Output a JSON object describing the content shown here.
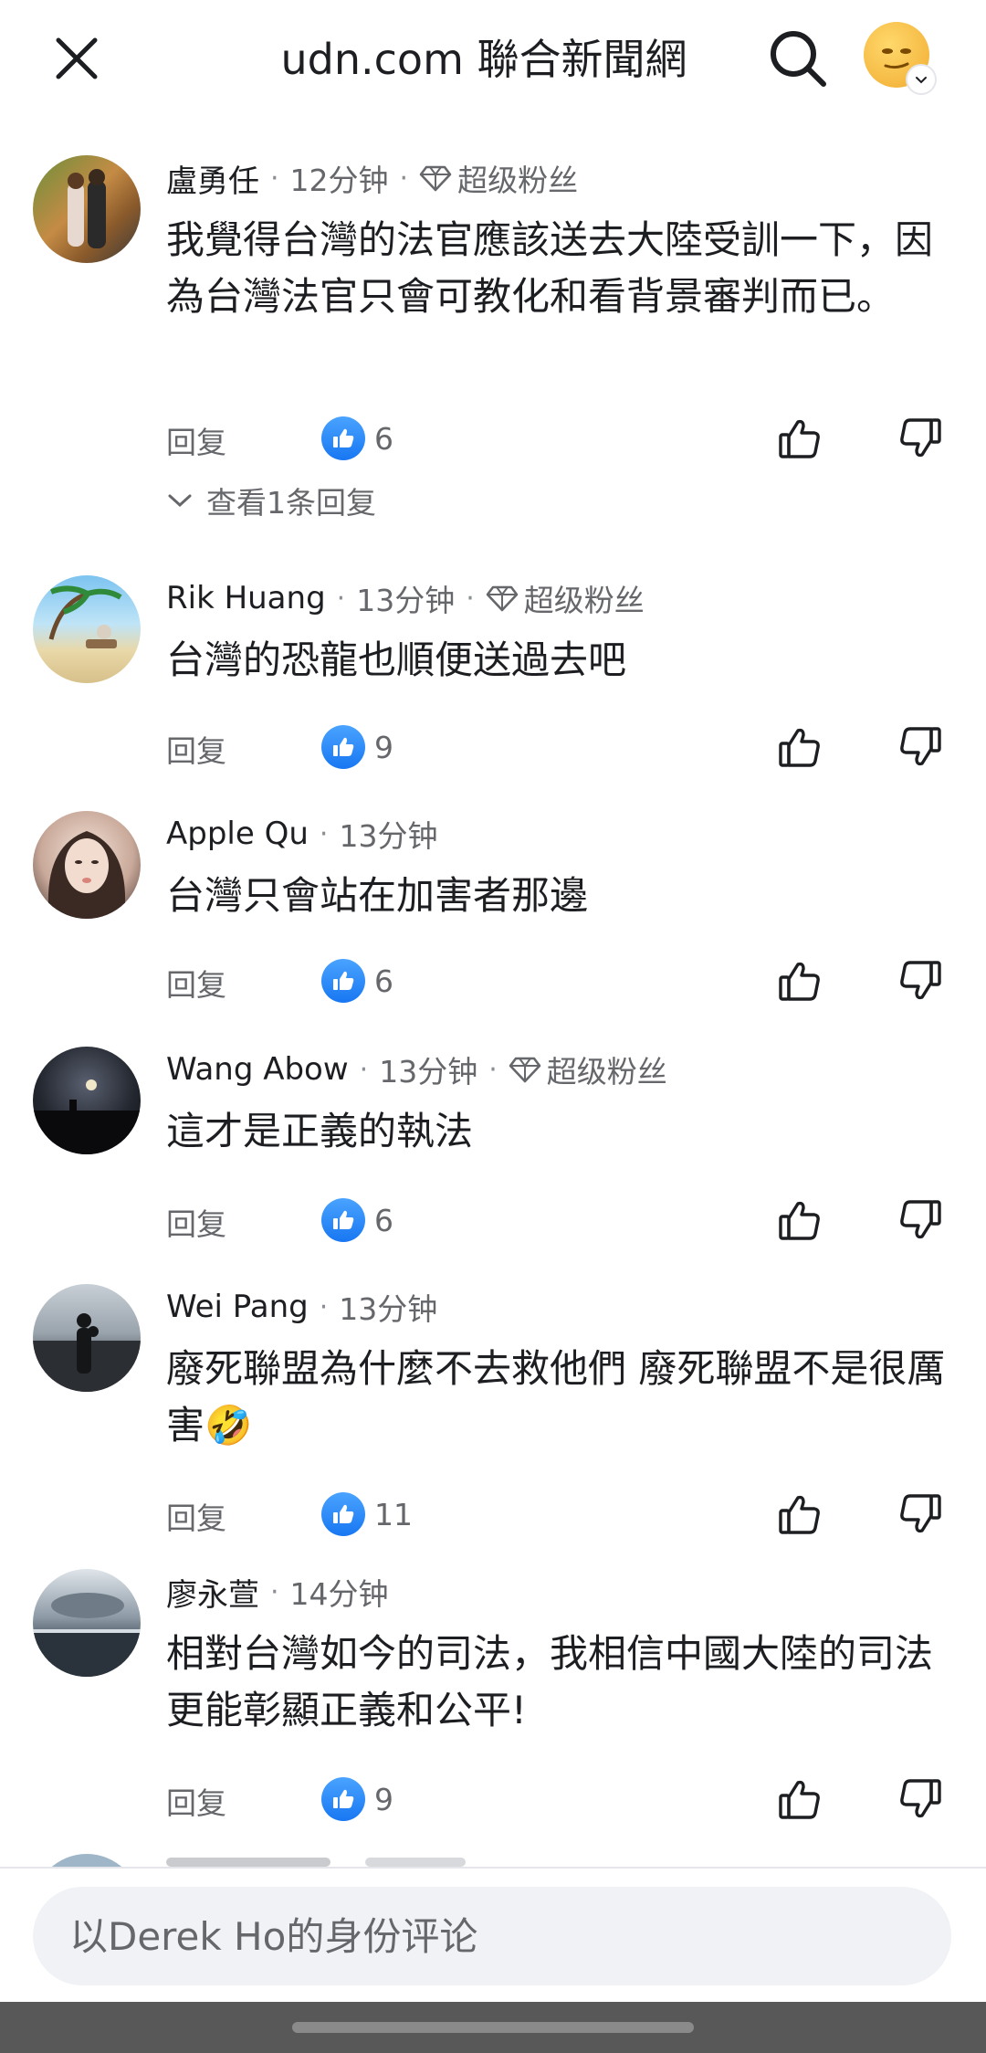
{
  "header": {
    "title": "udn.com 聯合新聞網"
  },
  "colors": {
    "like_blue": "#1877f2",
    "secondary_text": "#65676b",
    "input_bg": "#f0f2f5"
  },
  "super_fan_label": "超级粉丝",
  "reply_label": "回复",
  "comments": [
    {
      "author": "盧勇任",
      "time": "12分钟",
      "super_fan": true,
      "text": "我覺得台灣的法官應該送去大陸受訓一下，因為台灣法官只會可教化和看背景審判而已。",
      "likes": "6",
      "view_replies": "查看1条回复"
    },
    {
      "author": "Rik Huang",
      "time": "13分钟",
      "super_fan": true,
      "text": "台灣的恐龍也順便送過去吧",
      "likes": "9"
    },
    {
      "author": "Apple Qu",
      "time": "13分钟",
      "super_fan": false,
      "text": "台灣只會站在加害者那邊",
      "likes": "6"
    },
    {
      "author": "Wang Abow",
      "time": "13分钟",
      "super_fan": true,
      "text": "這才是正義的執法",
      "likes": "6"
    },
    {
      "author": "Wei Pang",
      "time": "13分钟",
      "super_fan": false,
      "text": "廢死聯盟為什麼不去救他們 廢死聯盟不是很厲害🤣",
      "likes": "11"
    },
    {
      "author": "廖永萱",
      "time": "14分钟",
      "super_fan": false,
      "text": "相對台灣如今的司法，我相信中國大陸的司法更能彰顯正義和公平!",
      "likes": "9"
    }
  ],
  "comment_box": {
    "placeholder": "以Derek Ho的身份评论"
  }
}
